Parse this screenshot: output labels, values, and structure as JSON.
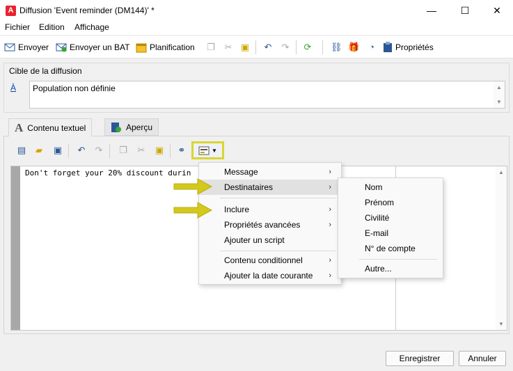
{
  "window": {
    "title": "Diffusion 'Event reminder (DM144)' *",
    "app_icon_glyph": "A",
    "controls": {
      "minimize": "—",
      "maximize": "☐",
      "close": "✕"
    }
  },
  "menubar": [
    "Fichier",
    "Edition",
    "Affichage"
  ],
  "toolbar": {
    "send": "Envoyer",
    "send_proof": "Envoyer un BAT",
    "schedule": "Planification",
    "properties": "Propriétés"
  },
  "target": {
    "group_label": "Cible de la diffusion",
    "link_label": "À",
    "value": "Population non définie"
  },
  "tabs": [
    {
      "label": "Contenu textuel",
      "icon": "A",
      "active": true
    },
    {
      "label": "Aperçu",
      "icon": "preview-icon",
      "active": false
    }
  ],
  "editor": {
    "text": "Don't forget your 20% discount durin"
  },
  "context_menu": {
    "items": [
      {
        "label": "Message",
        "has_submenu": true
      },
      {
        "label": "Destinataires",
        "has_submenu": true
      },
      {
        "label": "Inclure",
        "has_submenu": true
      },
      {
        "label": "Propriétés avancées",
        "has_submenu": true
      },
      {
        "label": "Ajouter un script",
        "has_submenu": false
      },
      {
        "label": "Contenu conditionnel",
        "has_submenu": true
      },
      {
        "label": "Ajouter la date courante",
        "has_submenu": true
      }
    ]
  },
  "submenu": {
    "items": [
      "Nom",
      "Prénom",
      "Civilité",
      "E-mail",
      "N° de compte",
      "Autre..."
    ]
  },
  "buttons": {
    "save": "Enregistrer",
    "cancel": "Annuler"
  },
  "colors": {
    "highlight_yellow": "#d8d630",
    "arrow_yellow": "#d4c81e",
    "brand_red": "#e8242f"
  }
}
